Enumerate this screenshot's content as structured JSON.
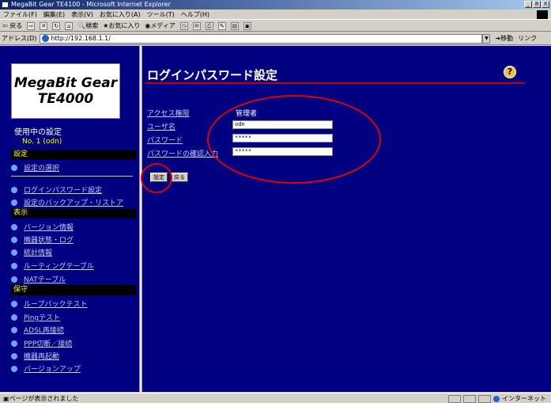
{
  "window": {
    "title": "MegaBit Gear TE4100 - Microsoft Internet Explorer",
    "controls": [
      "_",
      "8",
      "X"
    ]
  },
  "menu": [
    "ファイル(F)",
    "編集(E)",
    "表示(V)",
    "お気に入り(A)",
    "ツール(T)",
    "ヘルプ(H)"
  ],
  "toolbar": {
    "back": "戻る",
    "search": "検索",
    "favorites": "お気に入り",
    "media": "メディア"
  },
  "address": {
    "label": "アドレス(D)",
    "url": "http://192.168.1.1/",
    "go": "移動",
    "links": "リンク"
  },
  "sidebar": {
    "logo_line1": "MegaBit Gear",
    "logo_line2": "TE4000",
    "current_title": "使用中の設定",
    "current_no": "No. 1 (odn)",
    "section_settings": "設定",
    "item_select": "設定の選択",
    "item_login": "ログインパスワード設定",
    "item_backup": "設定のバックアップ・リストア",
    "section_display": "表示",
    "item_version": "バージョン情報",
    "item_status": "機器状態・ログ",
    "item_stats": "統計情報",
    "item_routing": "ルーティングテーブル",
    "item_nat": "NATテーブル",
    "section_maint": "保守",
    "item_loopback": "ループバックテスト",
    "item_ping": "Pingテスト",
    "item_adsl": "ADSL再接続",
    "item_ppp": "PPP切断／接続",
    "item_reboot": "機器再起動",
    "item_upgrade": "バージョンアップ"
  },
  "main": {
    "title": "ログインパスワード設定",
    "access_label": "アクセス権限",
    "access_value": "管理者",
    "user_label": "ユーザ名",
    "user_value": "odn",
    "password_label": "パスワード",
    "password_value": "*****",
    "confirm_label": "パスワードの確認入力",
    "confirm_value": "*****",
    "set_button": "設定",
    "back_button": "戻る"
  },
  "status": {
    "text": "ページが表示されました",
    "zone": "インターネット"
  },
  "colors": {
    "background": "#000080",
    "annotation": "#e00000",
    "link": "#c8c8ff"
  }
}
